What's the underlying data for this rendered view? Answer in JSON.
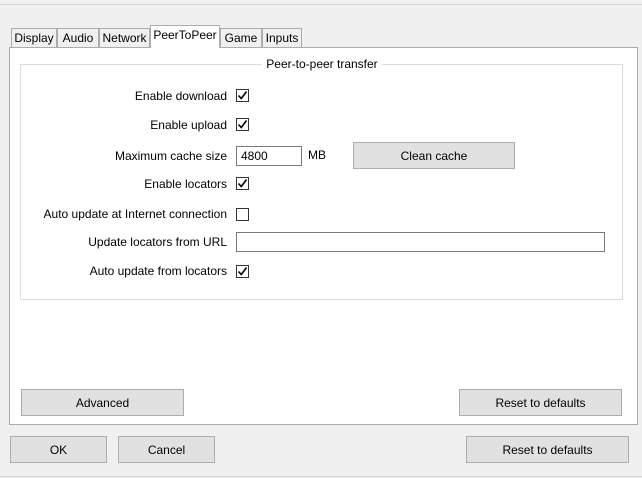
{
  "tabs": [
    "Display",
    "Audio",
    "Network",
    "PeerToPeer",
    "Game",
    "Inputs"
  ],
  "active_tab": "PeerToPeer",
  "group": {
    "title": "Peer-to-peer transfer",
    "enable_download": {
      "label": "Enable download",
      "checked": true
    },
    "enable_upload": {
      "label": "Enable upload",
      "checked": true
    },
    "max_cache": {
      "label": "Maximum cache size",
      "value": "4800",
      "unit": "MB",
      "button": "Clean cache"
    },
    "enable_locators": {
      "label": "Enable locators",
      "checked": true
    },
    "auto_update_internet": {
      "label": "Auto update at Internet connection",
      "checked": false
    },
    "update_url": {
      "label": "Update locators from URL",
      "value": ""
    },
    "auto_update_locators": {
      "label": "Auto update from locators",
      "checked": true
    }
  },
  "panel_buttons": {
    "advanced": "Advanced",
    "reset": "Reset to defaults"
  },
  "dialog_buttons": {
    "ok": "OK",
    "cancel": "Cancel",
    "reset": "Reset to defaults"
  }
}
